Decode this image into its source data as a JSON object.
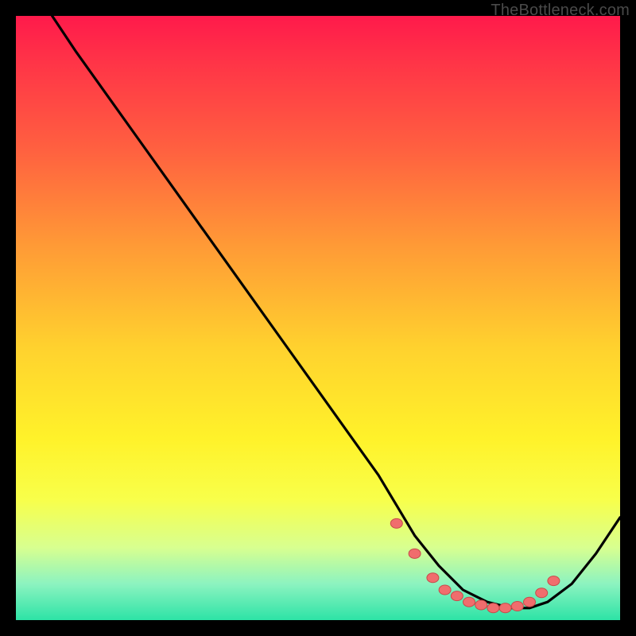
{
  "attribution": "TheBottleneck.com",
  "colors": {
    "frame": "#000000",
    "curve_stroke": "#000000",
    "marker_fill": "#f06d6d",
    "marker_stroke": "#c74a4a",
    "gradient_top": "#ff1a4b",
    "gradient_bottom": "#2de3a6"
  },
  "chart_data": {
    "type": "line",
    "title": "",
    "xlabel": "",
    "ylabel": "",
    "xlim": [
      0,
      100
    ],
    "ylim": [
      0,
      100
    ],
    "grid": false,
    "legend": false,
    "note": "Axes are normalized 0–100; no numeric tick labels are present in the image. Values are read from the curve relative to the gradient plot area.",
    "series": [
      {
        "name": "curve",
        "x": [
          6,
          10,
          15,
          20,
          25,
          30,
          35,
          40,
          45,
          50,
          55,
          60,
          63,
          66,
          70,
          74,
          78,
          82,
          85,
          88,
          92,
          96,
          100
        ],
        "y": [
          100,
          94,
          87,
          80,
          73,
          66,
          59,
          52,
          45,
          38,
          31,
          24,
          19,
          14,
          9,
          5,
          3,
          2,
          2,
          3,
          6,
          11,
          17
        ]
      }
    ],
    "markers": {
      "name": "highlight-points",
      "x": [
        63,
        66,
        69,
        71,
        73,
        75,
        77,
        79,
        81,
        83,
        85,
        87,
        89
      ],
      "y": [
        16,
        11,
        7,
        5,
        4,
        3,
        2.5,
        2,
        2,
        2.3,
        3,
        4.5,
        6.5
      ]
    }
  }
}
